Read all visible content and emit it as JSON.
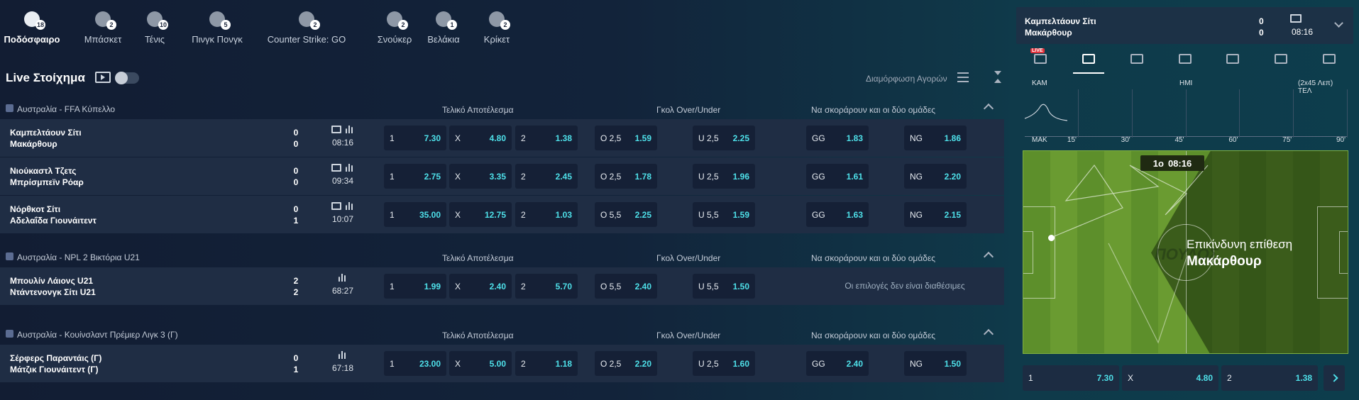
{
  "sports": [
    {
      "label": "Ποδόσφαιρο",
      "count": "18",
      "icon": "football-icon",
      "active": true
    },
    {
      "label": "Μπάσκετ",
      "count": "2",
      "icon": "basketball-icon"
    },
    {
      "label": "Τένις",
      "count": "10",
      "icon": "tennis-icon"
    },
    {
      "label": "Πινγκ Πονγκ",
      "count": "5",
      "icon": "table-tennis-icon"
    },
    {
      "label": "Counter Strike: GO",
      "count": "2",
      "icon": "counter-strike-icon"
    },
    {
      "label": "Σνούκερ",
      "count": "2",
      "icon": "snooker-icon"
    },
    {
      "label": "Βελάκια",
      "count": "1",
      "icon": "darts-icon"
    },
    {
      "label": "Κρίκετ",
      "count": "2",
      "icon": "cricket-icon"
    }
  ],
  "header": {
    "title": "Live Στοίχημα",
    "markets_config": "Διαμόρφωση Αγορών"
  },
  "market_headers": {
    "result": "Τελικό Αποτέλεσμα",
    "over_under": "Γκολ Over/Under",
    "btts": "Να σκοράρουν και οι δύο ομάδες"
  },
  "leagues": [
    {
      "name": "Αυστραλία - FFA Κύπελλο",
      "matches": [
        {
          "home": "Καμπελτάουν Σίτι",
          "away": "Μακάρθουρ",
          "sh": "0",
          "sa": "0",
          "time": "08:16",
          "tv": true,
          "odds": [
            [
              "1",
              "7.30"
            ],
            [
              "X",
              "4.80"
            ],
            [
              "2",
              "1.38"
            ],
            [
              "O 2,5",
              "1.59"
            ],
            [
              "U 2,5",
              "2.25"
            ],
            [
              "GG",
              "1.83"
            ],
            [
              "NG",
              "1.86"
            ]
          ]
        },
        {
          "home": "Νιούκαστλ Τζετς",
          "away": "Μπρίσμπεϊν Ρόαρ",
          "sh": "0",
          "sa": "0",
          "time": "09:34",
          "tv": true,
          "odds": [
            [
              "1",
              "2.75"
            ],
            [
              "X",
              "3.35"
            ],
            [
              "2",
              "2.45"
            ],
            [
              "O 2,5",
              "1.78"
            ],
            [
              "U 2,5",
              "1.96"
            ],
            [
              "GG",
              "1.61"
            ],
            [
              "NG",
              "2.20"
            ]
          ]
        },
        {
          "home": "Νόρθκοτ Σίτι",
          "away": "Αδελαΐδα Γιουνάιτεντ",
          "sh": "0",
          "sa": "1",
          "time": "10:07",
          "tv": true,
          "odds": [
            [
              "1",
              "35.00"
            ],
            [
              "X",
              "12.75"
            ],
            [
              "2",
              "1.03"
            ],
            [
              "O 5,5",
              "2.25"
            ],
            [
              "U 5,5",
              "1.59"
            ],
            [
              "GG",
              "1.63"
            ],
            [
              "NG",
              "2.15"
            ]
          ]
        }
      ]
    },
    {
      "name": "Αυστραλία - NPL 2 Βικτόρια U21",
      "matches": [
        {
          "home": "Μπουλίν Λάιονς U21",
          "away": "Ντάντενονγκ Σίτι U21",
          "sh": "2",
          "sa": "2",
          "time": "68:27",
          "tv": false,
          "odds": [
            [
              "1",
              "1.99"
            ],
            [
              "X",
              "2.40"
            ],
            [
              "2",
              "5.70"
            ],
            [
              "O 5,5",
              "2.40"
            ],
            [
              "U 5,5",
              "1.50"
            ]
          ],
          "btts_unavailable": "Οι επιλογές δεν είναι διαθέσιμες"
        }
      ]
    },
    {
      "name": "Αυστραλία - Κουίνσλαντ Πρέμιερ Λιγκ 3 (Γ)",
      "matches": [
        {
          "home": "Σέρφερς Παραντάις (Γ)",
          "away": "Μάτζικ Γιουνάιτεντ (Γ)",
          "sh": "0",
          "sa": "1",
          "time": "67:18",
          "tv": false,
          "odds": [
            [
              "1",
              "23.00"
            ],
            [
              "X",
              "5.00"
            ],
            [
              "2",
              "1.18"
            ],
            [
              "O 2,5",
              "2.20"
            ],
            [
              "U 2,5",
              "1.60"
            ],
            [
              "GG",
              "2.40"
            ],
            [
              "NG",
              "1.50"
            ]
          ]
        }
      ]
    }
  ],
  "side": {
    "home": "Καμπελτάουν Σίτι",
    "away": "Μακάρθουρ",
    "sh": "0",
    "sa": "0",
    "time": "08:16",
    "tabs": [
      "live-tv-icon",
      "pitch-icon",
      "stats-icon",
      "timeline-icon",
      "lineup-icon",
      "commentary-icon",
      "teams-icon"
    ],
    "live_badge": "LIVE",
    "timeline": {
      "home": "KAM",
      "away": "MAK",
      "half": "HMI",
      "format": "(2x45 Λεπ) TEΛ",
      "ticks": [
        "15'",
        "30'",
        "45'",
        "60'",
        "75'",
        "90'"
      ]
    },
    "pitch": {
      "period": "1ο",
      "clock": "08:16",
      "event": "Επικίνδυνη επίθεση",
      "team": "Μακάρθουρ",
      "watermark": "ΠΟΥΛΟΣ"
    },
    "odds": [
      [
        "1",
        "7.30"
      ],
      [
        "X",
        "4.80"
      ],
      [
        "2",
        "1.38"
      ]
    ]
  }
}
